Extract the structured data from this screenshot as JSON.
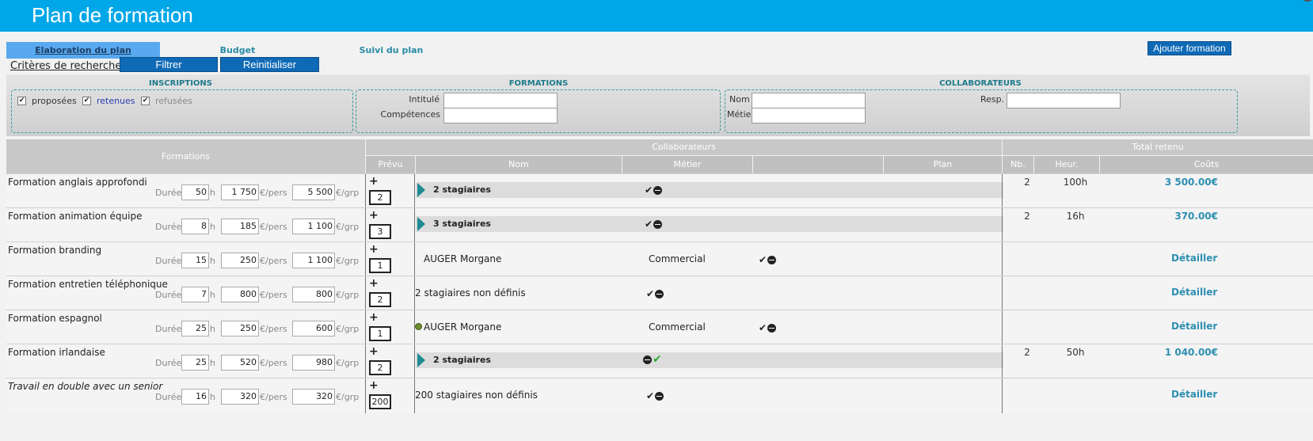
{
  "header": {
    "title": "Plan de formation"
  },
  "tabs": [
    {
      "label": "Elaboration du plan",
      "active": true
    },
    {
      "label": "Budget"
    },
    {
      "label": "Suivi du plan"
    }
  ],
  "actions": {
    "add": "Ajouter formation",
    "criteria": "Critères de recherche",
    "filter": "Filtrer",
    "reset": "Reinitialiser"
  },
  "filters": {
    "inscriptions": {
      "title": "INSCRIPTIONS",
      "options": [
        {
          "label": "proposées",
          "checked": true
        },
        {
          "label": "retenues",
          "checked": true
        },
        {
          "label": "refusées",
          "checked": true
        }
      ]
    },
    "formations": {
      "title": "FORMATIONS",
      "fields": [
        {
          "label": "Intitulé",
          "value": ""
        },
        {
          "label": "Compétences",
          "value": ""
        }
      ]
    },
    "collaborateurs": {
      "title": "COLLABORATEURS",
      "fields": [
        {
          "label": "Nom",
          "value": ""
        },
        {
          "label": "Métier",
          "value": ""
        },
        {
          "label": "Resp.",
          "value": ""
        }
      ]
    }
  },
  "table": {
    "headers": {
      "formations": "Formations",
      "collaborateurs": "Collaborateurs",
      "total": "Total retenu",
      "prevu": "Prévu",
      "nom": "Nom",
      "metier": "Métier",
      "plan": "Plan",
      "nb": "Nb.",
      "heur": "Heur.",
      "couts": "Coûts"
    },
    "units": {
      "duree": "Durée",
      "h": "h",
      "pers": "€/pers",
      "grp": "€/grp"
    },
    "rows": [
      {
        "name": "Formation anglais approfondi",
        "duree": "50",
        "pers": "1 750",
        "grp": "5 500",
        "prevu": "2",
        "collab": "2 stagiaires",
        "nb": "2",
        "heur": "100h",
        "cost": "3 500.00€"
      },
      {
        "name": "Formation animation équipe",
        "duree": "8",
        "pers": "185",
        "grp": "1 100",
        "prevu": "3",
        "collab": "3 stagiaires",
        "nb": "2",
        "heur": "16h",
        "cost": "370.00€"
      },
      {
        "name": "Formation branding",
        "duree": "15",
        "pers": "250",
        "grp": "1 100",
        "prevu": "1",
        "collab": "AUGER Morgane",
        "metier": "Commercial",
        "detail": "Détailler"
      },
      {
        "name": "Formation entretien téléphonique",
        "duree": "7",
        "pers": "800",
        "grp": "800",
        "prevu": "2",
        "collab": "2 stagiaires non définis",
        "detail": "Détailler"
      },
      {
        "name": "Formation espagnol",
        "duree": "25",
        "pers": "250",
        "grp": "600",
        "prevu": "1",
        "collab": "AUGER Morgane",
        "metier": "Commercial",
        "detail": "Détailler"
      },
      {
        "name": "Formation irlandaise",
        "duree": "25",
        "pers": "520",
        "grp": "980",
        "prevu": "2",
        "collab": "2 stagiaires",
        "nb": "2",
        "heur": "50h",
        "cost": "1 040.00€"
      },
      {
        "name": "Travail en double avec un senior",
        "duree": "16",
        "pers": "320",
        "grp": "320",
        "prevu": "200",
        "collab": "200 stagiaires non définis",
        "detail": "Détailler"
      }
    ]
  }
}
